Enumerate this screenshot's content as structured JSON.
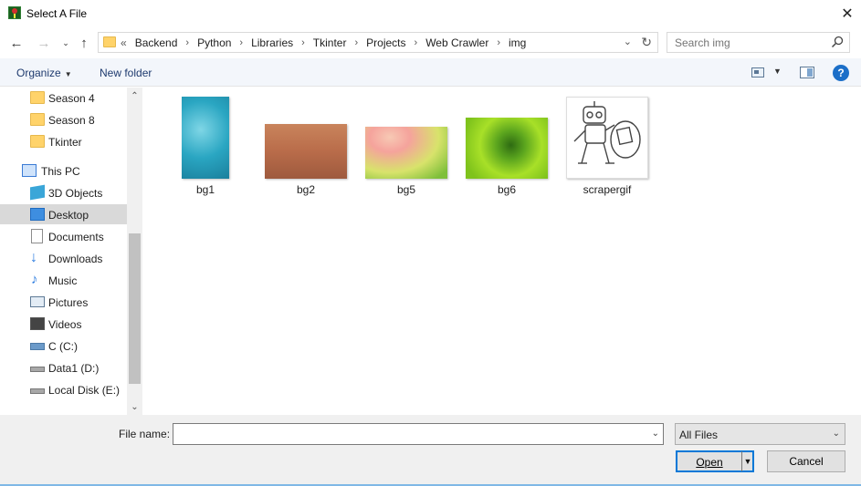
{
  "window": {
    "title": "Select A File"
  },
  "address": {
    "overflow": "«",
    "crumbs": [
      "Backend",
      "Python",
      "Libraries",
      "Tkinter",
      "Projects",
      "Web Crawler",
      "img"
    ]
  },
  "search": {
    "placeholder": "Search img"
  },
  "toolbar": {
    "organize_label": "Organize",
    "new_folder_label": "New folder"
  },
  "sidebar": {
    "items": [
      {
        "label": "Season 4",
        "icon": "folder-icon"
      },
      {
        "label": "Season 8",
        "icon": "folder-icon"
      },
      {
        "label": "Tkinter",
        "icon": "folder-icon"
      },
      {
        "label": "This PC",
        "icon": "computer-icon"
      },
      {
        "label": "3D Objects",
        "icon": "3d-objects-icon"
      },
      {
        "label": "Desktop",
        "icon": "desktop-icon",
        "selected": true
      },
      {
        "label": "Documents",
        "icon": "documents-icon"
      },
      {
        "label": "Downloads",
        "icon": "downloads-icon"
      },
      {
        "label": "Music",
        "icon": "music-icon"
      },
      {
        "label": "Pictures",
        "icon": "pictures-icon"
      },
      {
        "label": "Videos",
        "icon": "videos-icon"
      },
      {
        "label": "C (C:)",
        "icon": "drive-c-icon"
      },
      {
        "label": "Data1 (D:)",
        "icon": "drive-icon"
      },
      {
        "label": "Local Disk (E:)",
        "icon": "drive-icon"
      }
    ]
  },
  "files": [
    {
      "name": "bg1",
      "thumbnail": "teal-texture"
    },
    {
      "name": "bg2",
      "thumbnail": "brown-gradient"
    },
    {
      "name": "bg5",
      "thumbnail": "pink-green-gradient"
    },
    {
      "name": "bg6",
      "thumbnail": "green-swirl"
    },
    {
      "name": "scrapergif",
      "thumbnail": "robot-sketch"
    }
  ],
  "footer": {
    "filename_label": "File name:",
    "filename_value": "",
    "filter_value": "All Files",
    "open_label": "Open",
    "cancel_label": "Cancel"
  }
}
